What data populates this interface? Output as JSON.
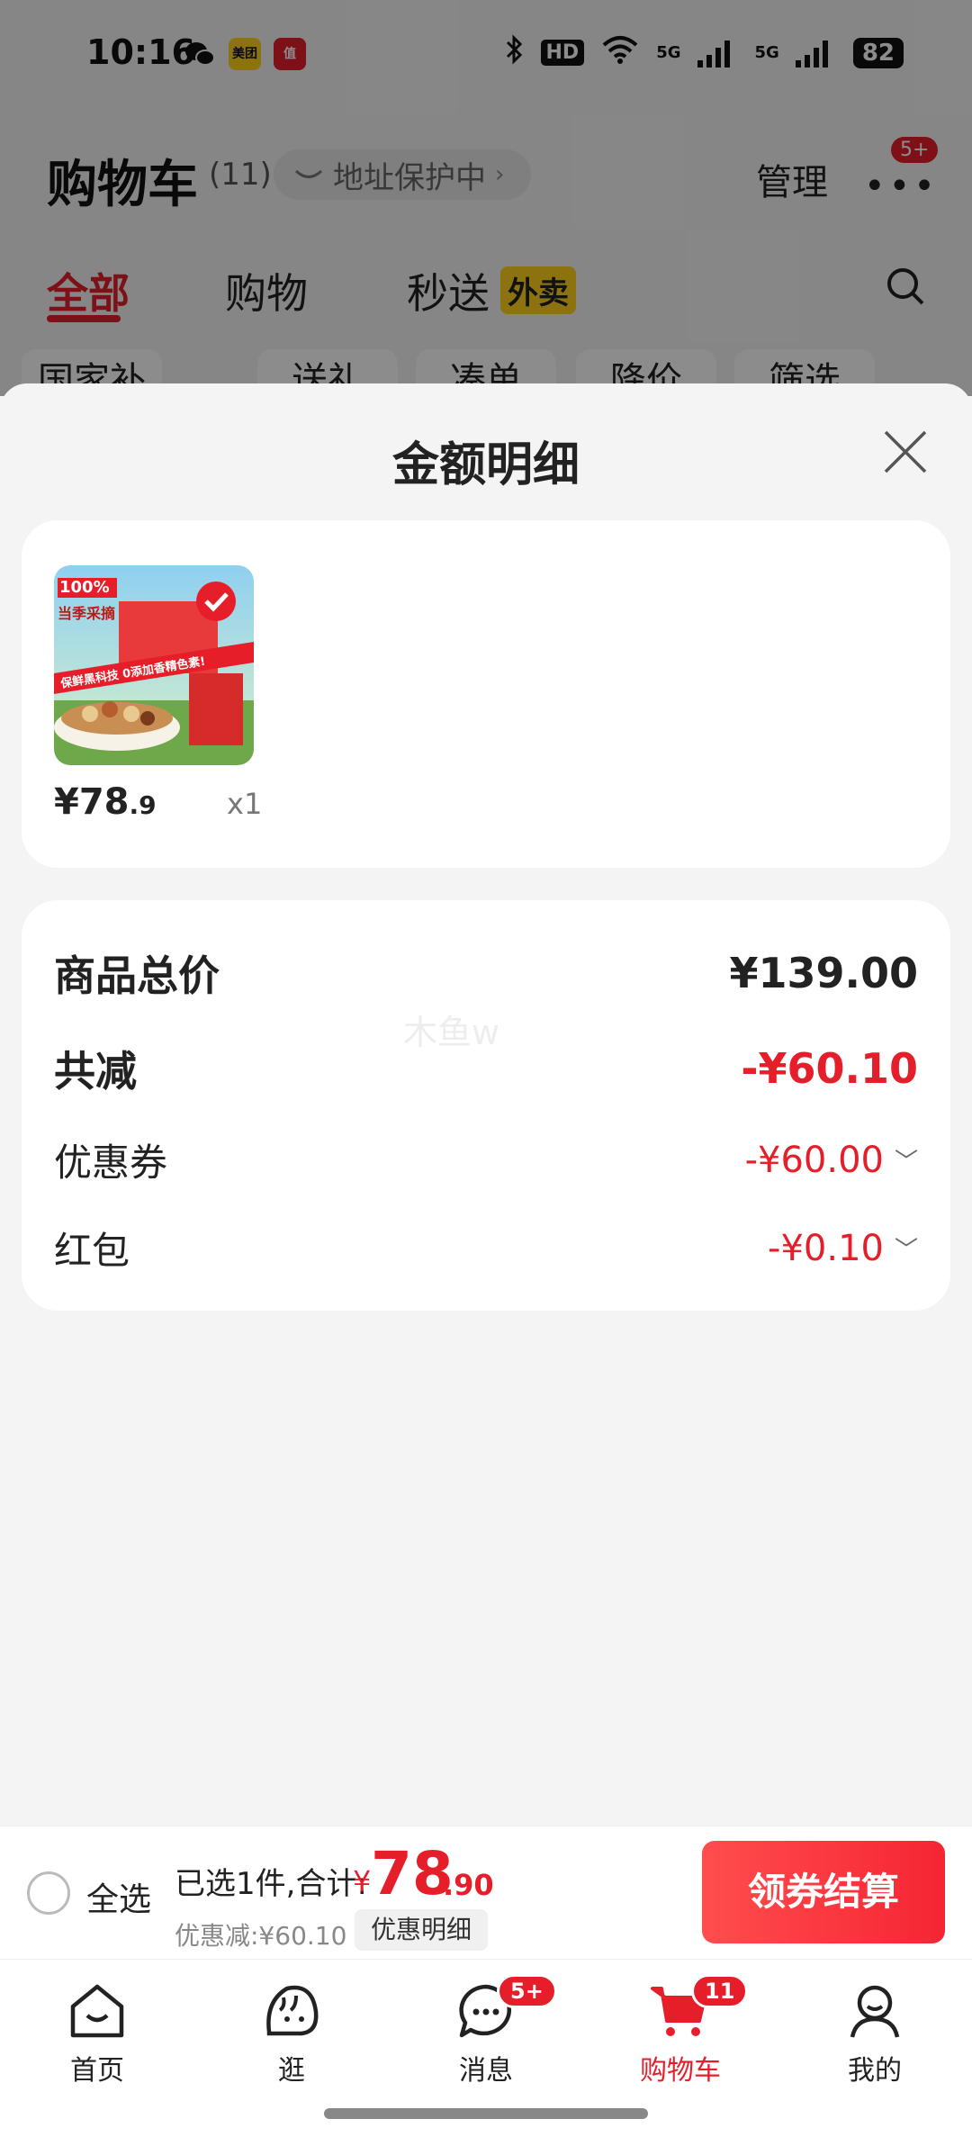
{
  "status_bar": {
    "time": "10:16",
    "apps": [
      "wechat-icon",
      "meituan-app-icon",
      "zhi-app-icon"
    ],
    "meituan_label": "美团",
    "zhi_label": "值",
    "hd_label": "HD",
    "net_label_1": "5G",
    "net_label_2": "5G",
    "battery": "82"
  },
  "background_page": {
    "title": "购物车",
    "count": "(11)",
    "address_label": "地址保护中",
    "manage_label": "管理",
    "more_badge": "5+",
    "tabs": [
      {
        "label": "全部",
        "active": true
      },
      {
        "label": "购物",
        "active": false
      },
      {
        "label": "秒送",
        "active": false
      }
    ],
    "waimai_badge": "外卖",
    "filter_chips": [
      "国家补贴",
      "送礼",
      "凑单",
      "降价",
      "筛选"
    ]
  },
  "sheet": {
    "title": "金额明细",
    "product": {
      "price_int": "¥78",
      "price_dec": ".9",
      "quantity": "x1",
      "image_badge": "100%",
      "image_text": "当季采摘",
      "image_banner": "保鲜黑科技 0添加香精色素!"
    },
    "summary": {
      "total_label": "商品总价",
      "total_value": "¥139.00",
      "reduce_label": "共减",
      "reduce_value": "-¥60.10",
      "coupon_label": "优惠券",
      "coupon_value": "-¥60.00",
      "redpacket_label": "红包",
      "redpacket_value": "-¥0.10",
      "watermark": "木鱼w"
    }
  },
  "checkout_bar": {
    "select_all": "全选",
    "selected_info": "已选1件,合计:",
    "total_symbol": "¥",
    "total_int": "78",
    "total_dec": ".90",
    "discount_info": "优惠减:¥60.10",
    "detail_chip": "优惠明细",
    "checkout_button": "领券结算"
  },
  "bottom_nav": {
    "items": [
      {
        "label": "首页",
        "icon": "home-icon",
        "active": false
      },
      {
        "label": "逛",
        "icon": "explore-icon",
        "active": false
      },
      {
        "label": "消息",
        "icon": "message-icon",
        "active": false,
        "badge": "5+"
      },
      {
        "label": "购物车",
        "icon": "cart-icon",
        "active": true,
        "badge": "11"
      },
      {
        "label": "我的",
        "icon": "profile-icon",
        "active": false
      }
    ]
  },
  "colors": {
    "accent": "#e61e2a",
    "waimai": "#ffd21e"
  }
}
